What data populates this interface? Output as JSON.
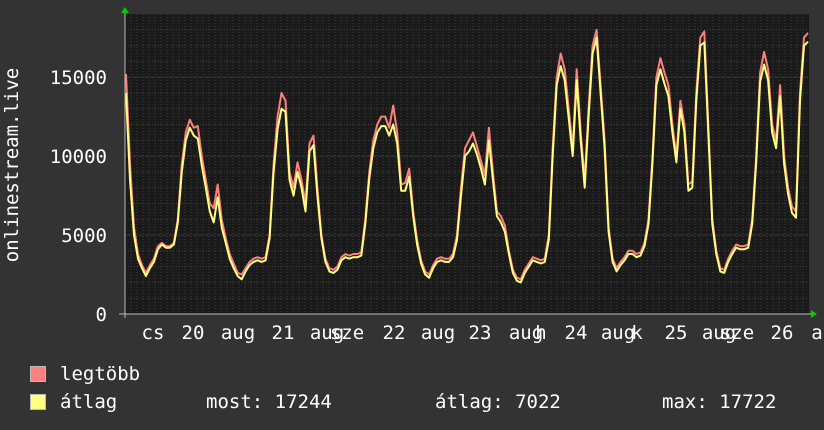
{
  "chart_data": {
    "type": "line",
    "ylabel": "onlinestream.live",
    "ylim": [
      0,
      19000
    ],
    "yticks": [
      0,
      5000,
      10000,
      15000
    ],
    "x_labels": [
      "cs",
      "20",
      "aug",
      "21",
      "aug",
      "sze",
      "22",
      "aug",
      "23",
      "aug",
      "h",
      "24",
      "aug",
      "k",
      "25",
      "aug",
      "sze",
      "26",
      "a"
    ],
    "grid": true,
    "series": [
      {
        "name": "legtöbb",
        "color": "#ff7f7f",
        "values": [
          15200,
          9500,
          5500,
          3800,
          3100,
          2600,
          3100,
          3500,
          4300,
          4500,
          4300,
          4300,
          4500,
          6000,
          9500,
          11500,
          12300,
          11800,
          11900,
          10000,
          8500,
          7000,
          6700,
          8200,
          6000,
          4800,
          3800,
          3200,
          2600,
          2500,
          2900,
          3300,
          3500,
          3600,
          3500,
          3600,
          5000,
          9500,
          12500,
          14000,
          13500,
          9000,
          8000,
          9600,
          8500,
          7000,
          10800,
          11300,
          8000,
          5000,
          3500,
          2900,
          2800,
          3000,
          3600,
          3800,
          3700,
          3800,
          3800,
          3900,
          6000,
          9000,
          11000,
          12000,
          12500,
          12500,
          11800,
          13200,
          11500,
          8200,
          8300,
          9200,
          6500,
          4700,
          3400,
          2700,
          2500,
          3100,
          3500,
          3600,
          3500,
          3500,
          3800,
          5000,
          8000,
          10500,
          11000,
          11500,
          10600,
          9700,
          8800,
          11800,
          9000,
          6500,
          6200,
          5600,
          4000,
          2800,
          2300,
          2200,
          2800,
          3200,
          3600,
          3500,
          3400,
          3500,
          5000,
          10500,
          15000,
          16500,
          15500,
          13000,
          10500,
          15500,
          11500,
          8500,
          13000,
          17000,
          18000,
          14500,
          11000,
          5500,
          3500,
          2900,
          3300,
          3600,
          4000,
          4000,
          3800,
          3900,
          4500,
          6000,
          10000,
          15000,
          16200,
          15300,
          14500,
          12000,
          10000,
          13500,
          12000,
          8200,
          8400,
          14000,
          17500,
          17900,
          12000,
          6000,
          4000,
          2900,
          2800,
          3500,
          4000,
          4400,
          4300,
          4300,
          4400,
          6000,
          10000,
          15300,
          16600,
          15500,
          12000,
          11000,
          14500,
          10000,
          8000,
          6800,
          6500,
          14000,
          17500,
          17800
        ]
      },
      {
        "name": "átlag",
        "color": "#ffff80",
        "values": [
          14000,
          8500,
          5000,
          3500,
          2900,
          2400,
          2900,
          3300,
          4100,
          4400,
          4200,
          4200,
          4400,
          5800,
          9000,
          11000,
          11800,
          11300,
          11100,
          9400,
          8000,
          6500,
          5800,
          7400,
          5500,
          4500,
          3500,
          2900,
          2400,
          2200,
          2700,
          3100,
          3300,
          3400,
          3300,
          3400,
          4800,
          9000,
          11700,
          13000,
          12800,
          8500,
          7500,
          9000,
          8000,
          6500,
          10300,
          10700,
          7500,
          4800,
          3300,
          2700,
          2600,
          2800,
          3400,
          3600,
          3500,
          3600,
          3600,
          3700,
          5700,
          8600,
          10500,
          11500,
          11900,
          11900,
          11300,
          12000,
          10800,
          7800,
          7800,
          8700,
          6200,
          4400,
          3200,
          2500,
          2300,
          2900,
          3300,
          3400,
          3300,
          3300,
          3600,
          4700,
          7500,
          10000,
          10300,
          10800,
          10100,
          9200,
          8200,
          11000,
          8500,
          6200,
          5800,
          5200,
          3800,
          2600,
          2100,
          2000,
          2600,
          3000,
          3400,
          3300,
          3200,
          3300,
          4700,
          10000,
          14500,
          15700,
          14800,
          12400,
          10000,
          14800,
          11000,
          8000,
          12500,
          16500,
          17500,
          14000,
          10500,
          5200,
          3300,
          2700,
          3100,
          3400,
          3800,
          3800,
          3600,
          3700,
          4300,
          5700,
          9600,
          14500,
          15500,
          14600,
          13800,
          11500,
          9600,
          13000,
          11500,
          7800,
          8000,
          13500,
          17000,
          17200,
          11500,
          5700,
          3800,
          2700,
          2600,
          3300,
          3800,
          4200,
          4100,
          4100,
          4200,
          5700,
          9600,
          14700,
          15800,
          14800,
          11500,
          10500,
          13800,
          9500,
          7600,
          6400,
          6100,
          13500,
          17000,
          17244
        ]
      }
    ]
  },
  "legend": [
    {
      "label": "legtöbb",
      "color": "#ff7f7f"
    },
    {
      "label": "átlag",
      "color": "#ffff80"
    }
  ],
  "stats": {
    "now": "most: 17244",
    "avg": "átlag: 7022",
    "max": "max: 17722"
  }
}
